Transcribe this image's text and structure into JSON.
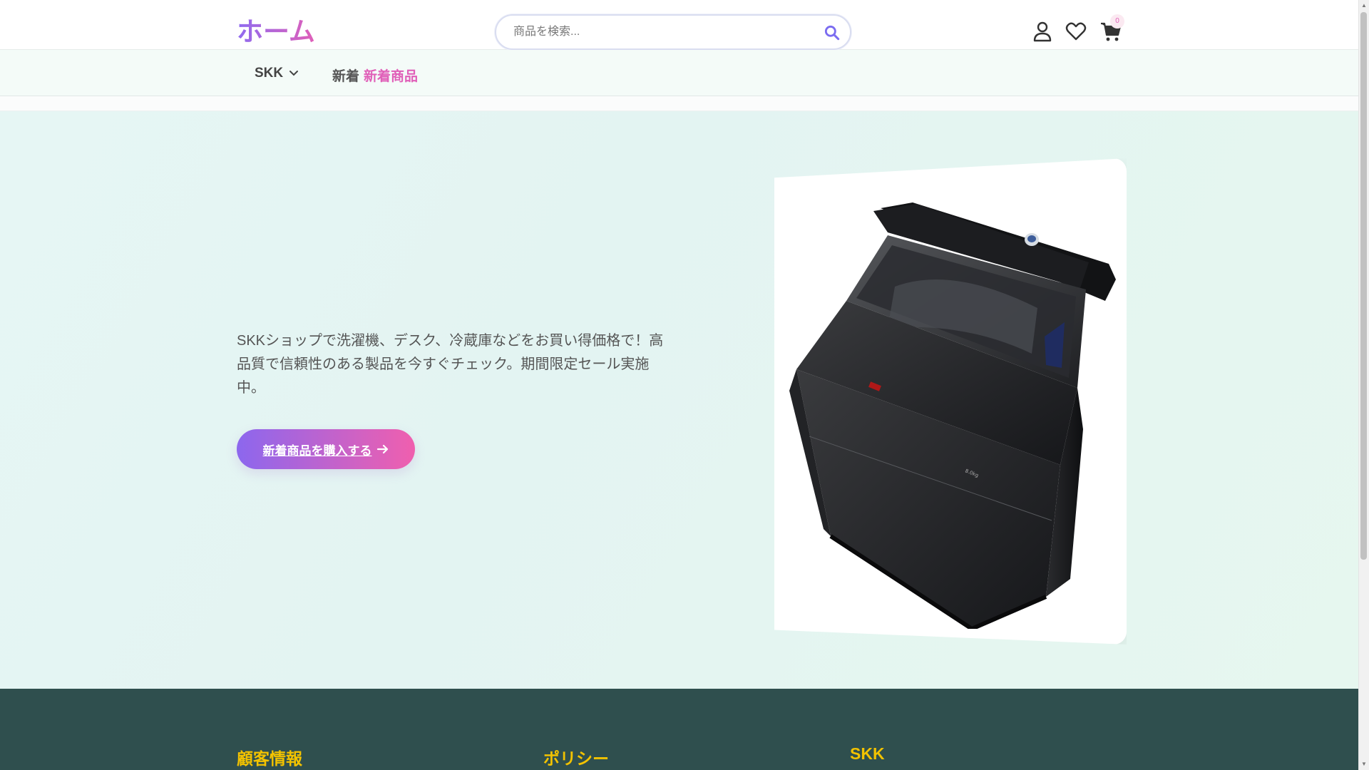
{
  "header": {
    "logo": "ホーム",
    "search_placeholder": "商品を検索...",
    "cart_count": "0"
  },
  "nav": {
    "skk": "SKK",
    "new_label": "新着",
    "new_products": "新着商品"
  },
  "hero": {
    "text": "SKKショップで洗濯機、デスク、冷蔵庫などをお買い得価格で！高品質で信頼性のある製品を今すぐチェック。期間限定セール実施中。",
    "cta": "新着商品を購入する"
  },
  "footer": {
    "customer_info": "顧客情報",
    "policy": "ポリシー",
    "skk": "SKK"
  },
  "colors": {
    "accent_purple": "#8c67ee",
    "accent_pink": "#f05fae",
    "footer_bg": "#2f4f4e",
    "footer_heading": "#f2c200"
  }
}
